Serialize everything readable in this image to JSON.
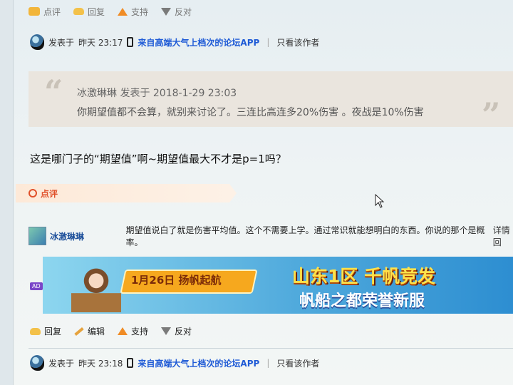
{
  "top_actions": {
    "comment": "点评",
    "reply": "回复",
    "support": "支持",
    "oppose": "反对"
  },
  "post1": {
    "meta_prefix": "发表于",
    "meta_time": "昨天 23:17",
    "app_link": "来自高端大气上档次的论坛APP",
    "only_author": "只看该作者"
  },
  "quote": {
    "author_line": "冰激琳琳 发表于 2018-1-29 23:03",
    "text": "你期望值都不会算，就别来讨论了。三连比高连多20%伤害 。夜战是10%伤害"
  },
  "body_text": "这是哪门子的“期望值”啊~期望值最大不才是p=1吗？",
  "rate_label": "点评",
  "comment": {
    "username": "冰激琳琳",
    "text": "期望值说白了就是伤害平均值。这个不需要上学。通过常识就能想明白的东西。你说的那个是概率。",
    "detail_link": "详情 回"
  },
  "ad": {
    "badge": "AD",
    "ribbon": "1月26日 扬帆起航",
    "title": "山东1区 千帆竞发",
    "subtitle": "帆船之都荣誉新服"
  },
  "post_actions": {
    "reply": "回复",
    "edit": "编辑",
    "support": "支持",
    "oppose": "反对"
  },
  "post2": {
    "meta_prefix": "发表于",
    "meta_time": "昨天 23:18",
    "app_link": "来自高端大气上档次的论坛APP",
    "only_author": "只看该作者"
  },
  "colors": {
    "link_blue": "#1f5bd6",
    "rate_orange": "#e0502a",
    "support_orange": "#f08c26"
  }
}
